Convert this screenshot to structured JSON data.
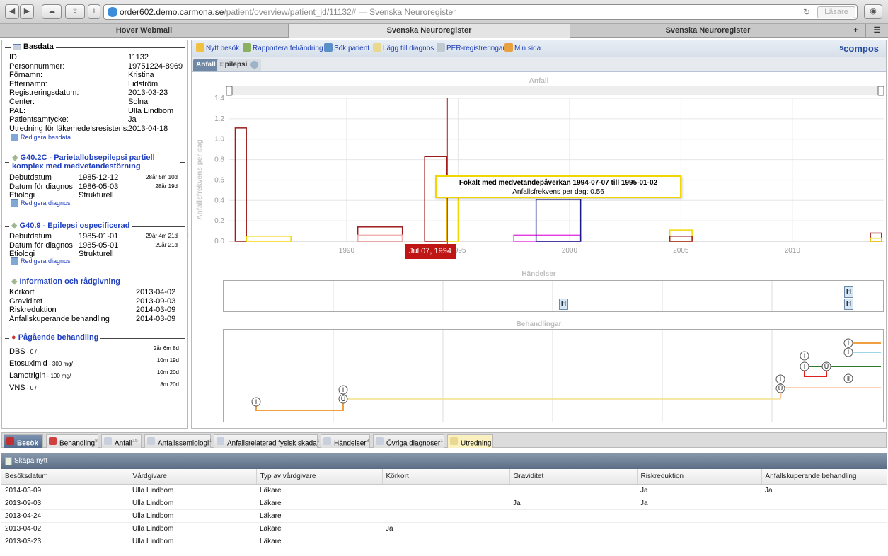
{
  "browser": {
    "url_main": "order602.demo.carmona.se",
    "url_path": "/patient/overview/patient_id/11132#",
    "url_title": " — Svenska Neuroregister",
    "reader_label": "Läsare",
    "tabs": [
      "Hover Webmail",
      "Svenska Neuroregister",
      "Svenska Neuroregister"
    ],
    "new_tab_label": "+"
  },
  "basdata": {
    "title": "Basdata",
    "rows": [
      {
        "label": "ID:",
        "value": "11132"
      },
      {
        "label": "Personnummer:",
        "value": "19751224-8969"
      },
      {
        "label": "Förnamn:",
        "value": "Kristina"
      },
      {
        "label": "Efternamn:",
        "value": "Lidström"
      },
      {
        "label": "Registreringsdatum:",
        "value": "2013-03-23"
      },
      {
        "label": "Center:",
        "value": "Solna"
      },
      {
        "label": "PAL:",
        "value": "Ulla Lindbom"
      },
      {
        "label": "Patientsamtycke:",
        "value": "Ja"
      },
      {
        "label": "Utredning för läkemedelsresistens:",
        "value": "2013-04-18"
      }
    ],
    "edit_link": "Redigera basdata"
  },
  "diagnos1": {
    "title_line1": "G40.2C - Parietallobsepilepsi partiell",
    "title_line2": "komplex med medvetandestörning",
    "rows": [
      {
        "label": "Debutdatum",
        "value": "1985-12-12",
        "extra": "28år 5m 10d"
      },
      {
        "label": "Datum för diagnos",
        "value": "1986-05-03",
        "extra": "28år 19d"
      },
      {
        "label": "Etiologi",
        "value": "Strukturell",
        "extra": ""
      }
    ],
    "edit_link": "Redigera diagnos"
  },
  "diagnos2": {
    "title": "G40.9 - Epilepsi ospecificerad",
    "rows": [
      {
        "label": "Debutdatum",
        "value": "1985-01-01",
        "extra": "29år 4m 21d"
      },
      {
        "label": "Datum för diagnos",
        "value": "1985-05-01",
        "extra": "29år 21d"
      },
      {
        "label": "Etiologi",
        "value": "Strukturell",
        "extra": ""
      }
    ],
    "edit_link": "Redigera diagnos"
  },
  "info": {
    "title": "Information och rådgivning",
    "rows": [
      {
        "label": "Körkort",
        "value": "2013-04-02"
      },
      {
        "label": "Graviditet",
        "value": "2013-09-03"
      },
      {
        "label": "Riskreduktion",
        "value": "2014-03-09"
      },
      {
        "label": "Anfallskuperande behandling",
        "value": "2014-03-09"
      }
    ]
  },
  "behandling": {
    "title": "Pågående behandling",
    "rows": [
      {
        "name": "DBS",
        "dose": " - 0 /",
        "duration": "2år 6m 8d"
      },
      {
        "name": "Etosuximid",
        "dose": " - 300 mg/",
        "duration": "10m 19d"
      },
      {
        "name": "Lamotrigin",
        "dose": " - 100 mg/",
        "duration": "10m 20d"
      },
      {
        "name": "VNS",
        "dose": " - 0 /",
        "duration": "8m 20d"
      }
    ]
  },
  "menu": {
    "items": [
      "Nytt besök",
      "Rapportera fel/ändring",
      "Sök patient",
      "Lägg till diagnos",
      "PER-registreringar",
      "Min sida"
    ],
    "logo": "compos"
  },
  "subtabs": [
    "Anfall",
    "Epilepsi"
  ],
  "chart_titles": {
    "anfall": "Anfall",
    "handelser": "Händelser",
    "behandlingar": "Behandlingar"
  },
  "chart_data": {
    "type": "bar",
    "title": "Anfall",
    "ylabel": "Anfallsfrekvens per dag",
    "ylim": [
      0,
      1.4
    ],
    "yticks": [
      "0.0",
      "0.2",
      "0.4",
      "0.6",
      "0.8",
      "1.0",
      "1.2",
      "1.4"
    ],
    "xtick_labels": [
      "1990",
      "1995",
      "2000",
      "2005",
      "2010"
    ],
    "bars": [
      {
        "start": 1985.0,
        "end": 1985.5,
        "value": 1.11,
        "color": "#9e1b1b"
      },
      {
        "start": 1985.5,
        "end": 1987.5,
        "value": 0.05,
        "color": "#f2d600"
      },
      {
        "start": 1990.5,
        "end": 1992.5,
        "value": 0.14,
        "color": "#9e1b1b"
      },
      {
        "start": 1990.5,
        "end": 1992.5,
        "value": 0.06,
        "color": "#f0b0b0"
      },
      {
        "start": 1993.5,
        "end": 1994.5,
        "value": 0.83,
        "color": "#9e1b1b"
      },
      {
        "start": 1994.5,
        "end": 1995.0,
        "value": 0.56,
        "color": "#f2d600"
      },
      {
        "start": 1997.5,
        "end": 2000.5,
        "value": 0.06,
        "color": "#e33ce3"
      },
      {
        "start": 1998.5,
        "end": 2000.5,
        "value": 0.41,
        "color": "#1a1a8a"
      },
      {
        "start": 2004.5,
        "end": 2005.5,
        "value": 0.11,
        "color": "#f2d600"
      },
      {
        "start": 2004.5,
        "end": 2005.5,
        "value": 0.05,
        "color": "#9e1b1b"
      },
      {
        "start": 2013.5,
        "end": 2014.0,
        "value": 0.08,
        "color": "#9e1b1b"
      },
      {
        "start": 2013.5,
        "end": 2014.0,
        "value": 0.03,
        "color": "#f2d600"
      }
    ],
    "tooltip_title": "Fokalt med medvetandepåverkan 1994-07-07 till 1995-01-02",
    "tooltip_value": "Anfallsfrekvens per dag: 0.56",
    "crosshair_label": "Jul 07, 1994"
  },
  "events": {
    "marker": "H"
  },
  "bottom_tabs": [
    {
      "label": "Besök",
      "count": ""
    },
    {
      "label": "Behandling",
      "count": "8"
    },
    {
      "label": "Anfall",
      "count": "15"
    },
    {
      "label": "Anfallssemiologi",
      "count": "1"
    },
    {
      "label": "Anfallsrelaterad fysisk skada",
      "count": "1"
    },
    {
      "label": "Händelser",
      "count": "3"
    },
    {
      "label": "Övriga diagnoser",
      "count": "1"
    },
    {
      "label": "Utredning",
      "count": ""
    }
  ],
  "skapa_label": "Skapa nytt",
  "table": {
    "headers": [
      "Besöksdatum",
      "Vårdgivare",
      "Typ av vårdgivare",
      "Körkort",
      "Graviditet",
      "Riskreduktion",
      "Anfallskuperande behandling"
    ],
    "rows": [
      [
        "2014-03-09",
        "Ulla Lindbom",
        "Läkare",
        "",
        "",
        "Ja",
        "Ja"
      ],
      [
        "2013-09-03",
        "Ulla Lindbom",
        "Läkare",
        "",
        "Ja",
        "Ja",
        ""
      ],
      [
        "2013-04-24",
        "Ulla Lindbom",
        "Läkare",
        "",
        "",
        "",
        ""
      ],
      [
        "2013-04-02",
        "Ulla Lindbom",
        "Läkare",
        "Ja",
        "",
        "",
        ""
      ],
      [
        "2013-03-23",
        "Ulla Lindbom",
        "Läkare",
        "",
        "",
        "",
        ""
      ]
    ]
  }
}
